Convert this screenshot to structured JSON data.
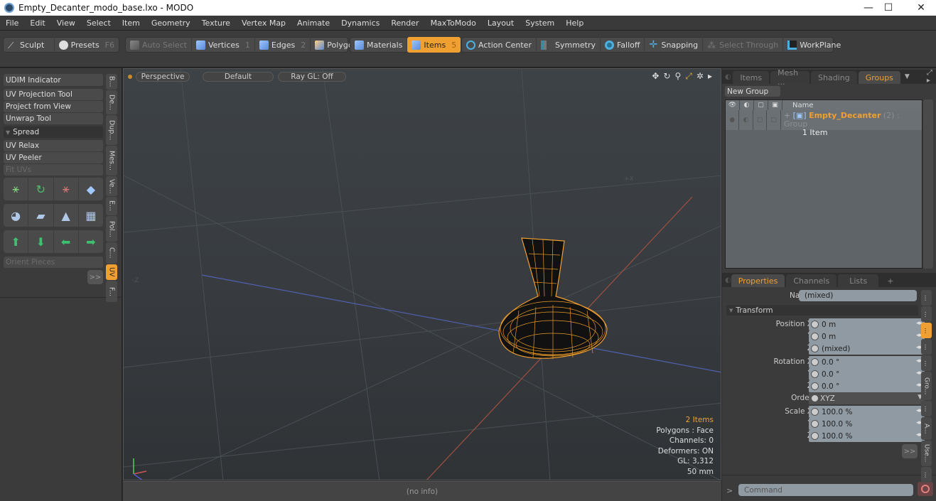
{
  "window": {
    "title": "Empty_Decanter_modo_base.lxo - MODO",
    "minimize": "—",
    "maximize": "☐",
    "close": "✕"
  },
  "menu": [
    "File",
    "Edit",
    "View",
    "Select",
    "Item",
    "Geometry",
    "Texture",
    "Vertex Map",
    "Animate",
    "Dynamics",
    "Render",
    "MaxToModo",
    "Layout",
    "System",
    "Help"
  ],
  "toolbar": {
    "sculpt": "Sculpt",
    "presets": "Presets",
    "presets_key": "F6",
    "auto_select": "Auto Select",
    "vertices": "Vertices",
    "vertices_key": "1",
    "edges": "Edges",
    "edges_key": "2",
    "polygons": "Polygons",
    "materials": "Materials",
    "items": "Items",
    "items_key": "5",
    "action_center": "Action Center",
    "symmetry": "Symmetry",
    "falloff": "Falloff",
    "snapping": "Snapping",
    "select_through": "Select Through",
    "workplane": "WorkPlane"
  },
  "left_panel": {
    "buttons": [
      "UDIM Indicator",
      "UV Projection Tool",
      "Project from View",
      "Unwrap Tool"
    ],
    "spread": "Spread",
    "buttons2": [
      "UV Relax",
      "UV Peeler",
      "Fit UVs"
    ],
    "orient": "Orient Pieces",
    "more": ">>",
    "vtabs": [
      "B...",
      "De...",
      "Dup...",
      "Mes...",
      "Ve...",
      "E...",
      "Pol...",
      "C...",
      "UV",
      "F..."
    ],
    "active_vtab": "UV"
  },
  "viewport": {
    "perspective": "Perspective",
    "default": "Default",
    "raygl": "Ray GL: Off",
    "axis_x": "+X",
    "axis_z": "-Z",
    "hud": {
      "items": "2 Items",
      "polygons": "Polygons : Face",
      "channels": "Channels: 0",
      "deformers": "Deformers: ON",
      "gl": "GL: 3,312",
      "scale": "50 mm"
    },
    "status": "(no info)"
  },
  "groups_panel": {
    "tabs": [
      "Items",
      "Mesh ...",
      "Shading",
      "Groups"
    ],
    "active_tab": "Groups",
    "new_group": "New Group",
    "col_name": "Name",
    "row": {
      "name": "Empty_Decanter",
      "count": "(2)",
      "type": ": Group",
      "sub": "1 Item"
    }
  },
  "properties_panel": {
    "tabs": [
      "Properties",
      "Channels",
      "Lists",
      "+"
    ],
    "active_tab": "Properties",
    "name_label": "Name",
    "name_value": "(mixed)",
    "section": "Transform",
    "rows": [
      {
        "label": "Position X",
        "value": "0 m"
      },
      {
        "label": "Y",
        "value": "0 m"
      },
      {
        "label": "Z",
        "value": "(mixed)"
      },
      {
        "label": "Rotation X",
        "value": "0.0 °"
      },
      {
        "label": "Y",
        "value": "0.0 °"
      },
      {
        "label": "Z",
        "value": "0.0 °"
      },
      {
        "label": "Order",
        "value": "XYZ"
      },
      {
        "label": "Scale X",
        "value": "100.0 %"
      },
      {
        "label": "Y",
        "value": "100.0 %"
      },
      {
        "label": "Z",
        "value": "100.0 %"
      }
    ],
    "more": ">>",
    "vtabs": [
      "...",
      "...",
      "...",
      "...",
      "...",
      "Gro...",
      "...",
      "A...",
      "Use...",
      "..."
    ]
  },
  "command": {
    "prompt": ">",
    "placeholder": "Command"
  },
  "colors": {
    "accent": "#f0a030",
    "selection": "#f0a030"
  }
}
